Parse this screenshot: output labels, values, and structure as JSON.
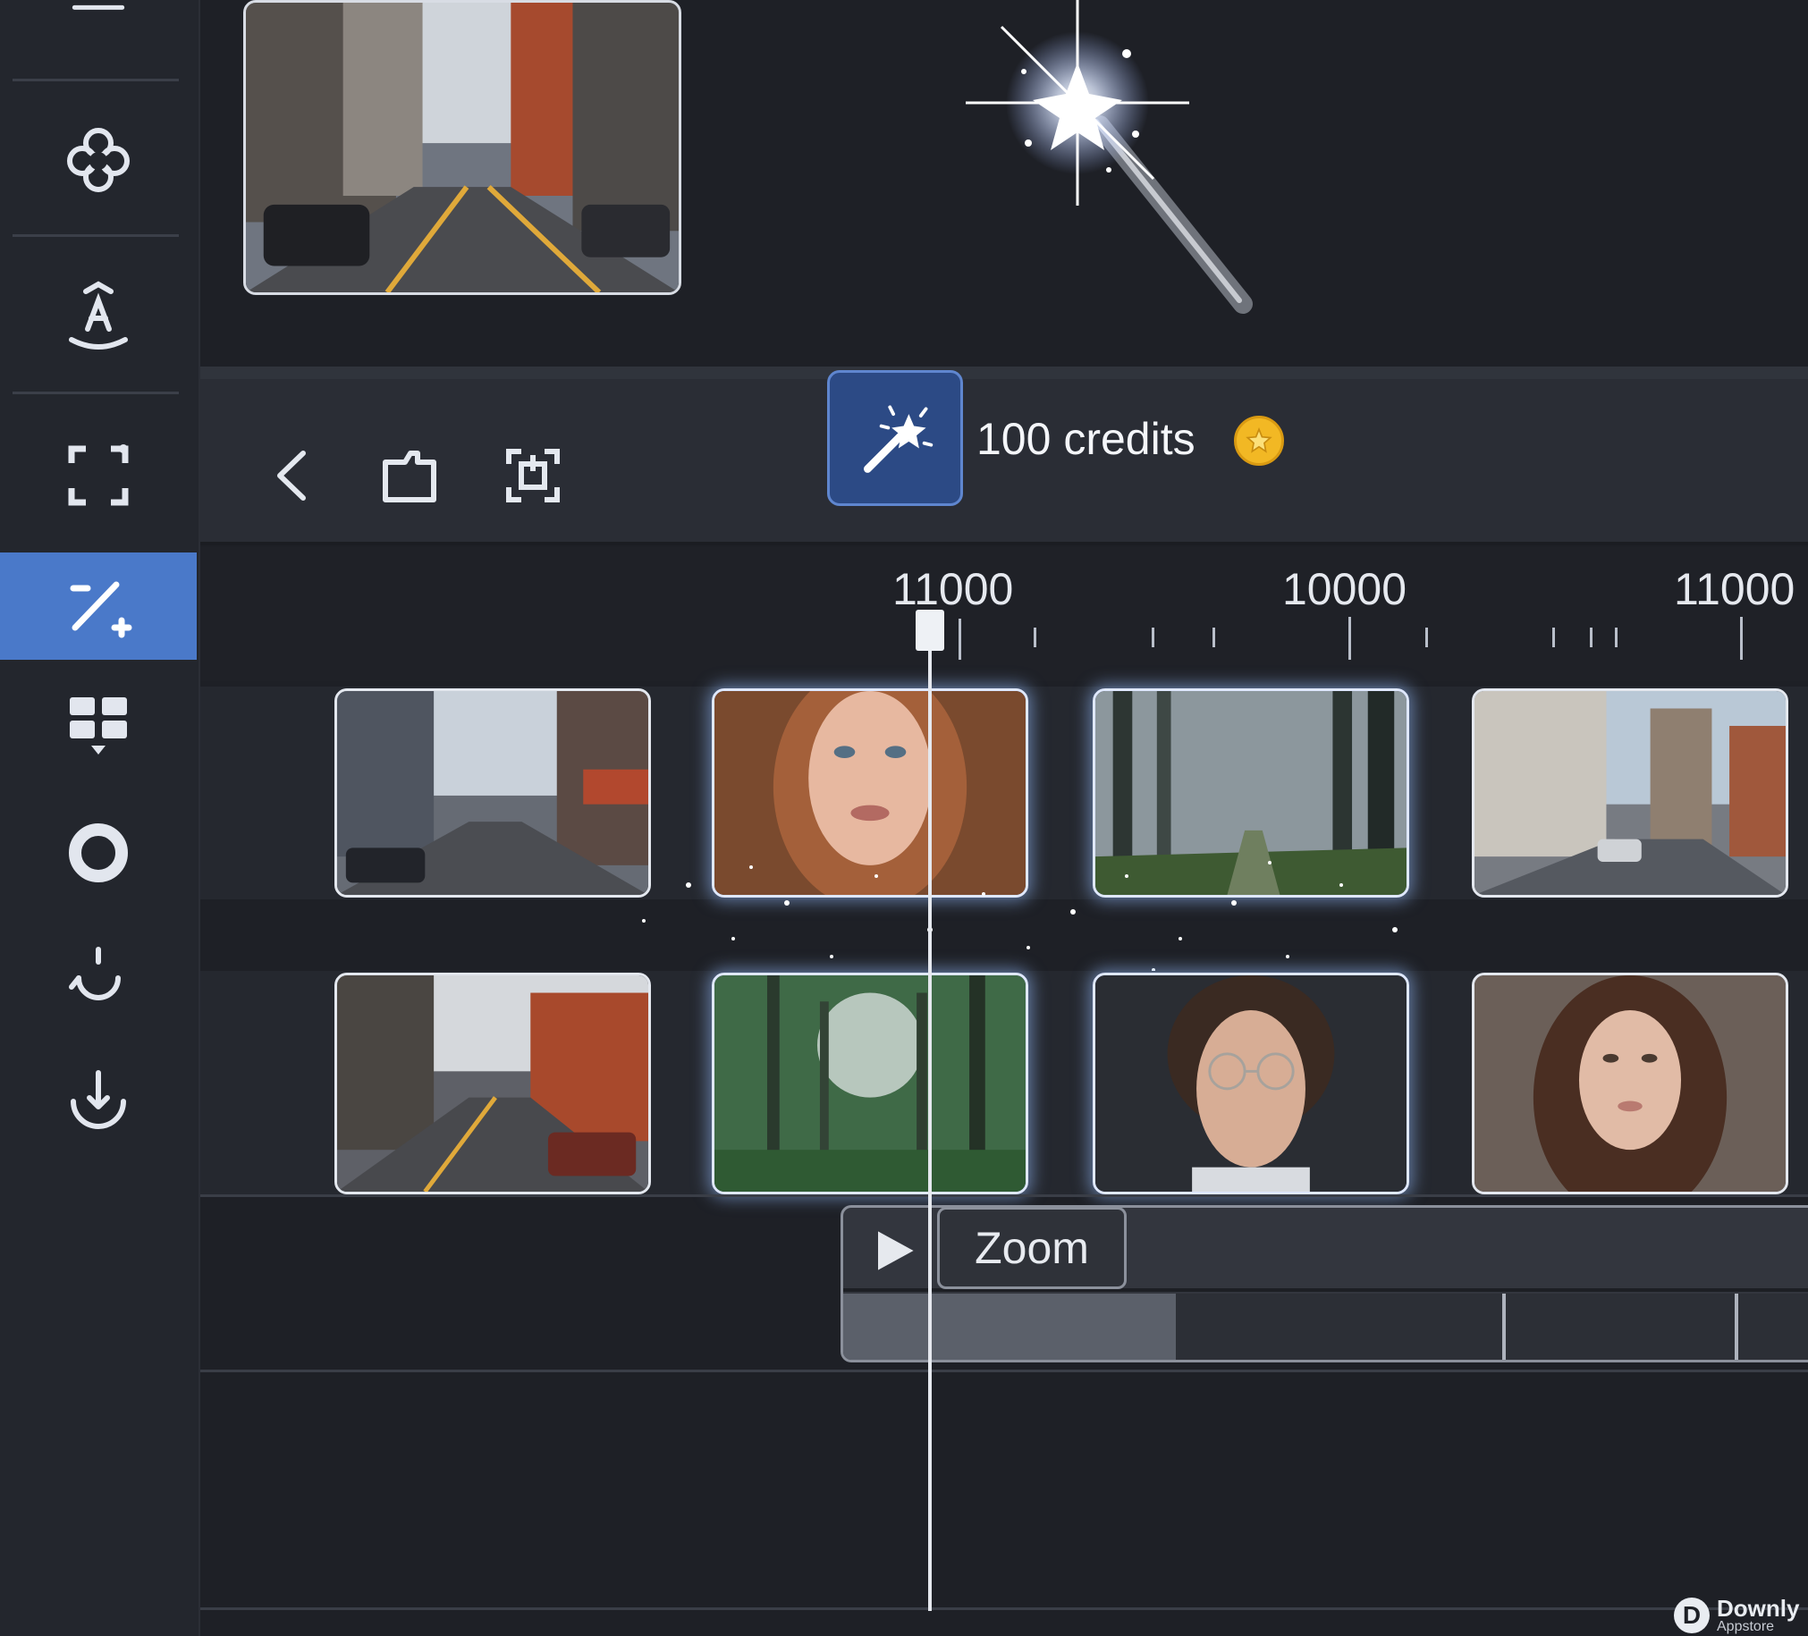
{
  "sidebar": {
    "items": [
      {
        "icon": "menu-icon"
      },
      {
        "icon": "clover-icon"
      },
      {
        "icon": "text-style-icon"
      },
      {
        "icon": "crop-frame-icon"
      },
      {
        "icon": "magic-add-icon",
        "active": true
      },
      {
        "icon": "layout-grid-icon"
      },
      {
        "icon": "record-circle-icon"
      },
      {
        "icon": "loop-icon"
      },
      {
        "icon": "download-icon"
      }
    ],
    "active_color": "#4a79c9"
  },
  "preview": {
    "thumbnail": "city-street-thumbnail",
    "effect_art": "magic-wand-sparkle-icon"
  },
  "toolbar": {
    "back_icon": "chevron-left-icon",
    "clip_icon": "folder-clip-icon",
    "extract_icon": "extract-frame-icon",
    "magic_icon": "magic-wand-icon",
    "credits_label": "100 credits",
    "coin_icon": "star-coin-icon",
    "coin_color": "#f2b824"
  },
  "ruler": {
    "labels": [
      "11000",
      "10000",
      "11000"
    ]
  },
  "tracks": [
    {
      "clips": [
        "city-street",
        "woman-portrait",
        "misty-forest",
        "city-corner"
      ]
    },
    {
      "clips": [
        "city-street-sunset",
        "green-forest",
        "man-glasses-portrait",
        "curly-hair-portrait"
      ]
    }
  ],
  "effect": {
    "play_icon": "play-icon",
    "label": "Zoom"
  },
  "watermark": {
    "brand": "Downly",
    "sub": "Appstore",
    "logo_letter": "D"
  }
}
